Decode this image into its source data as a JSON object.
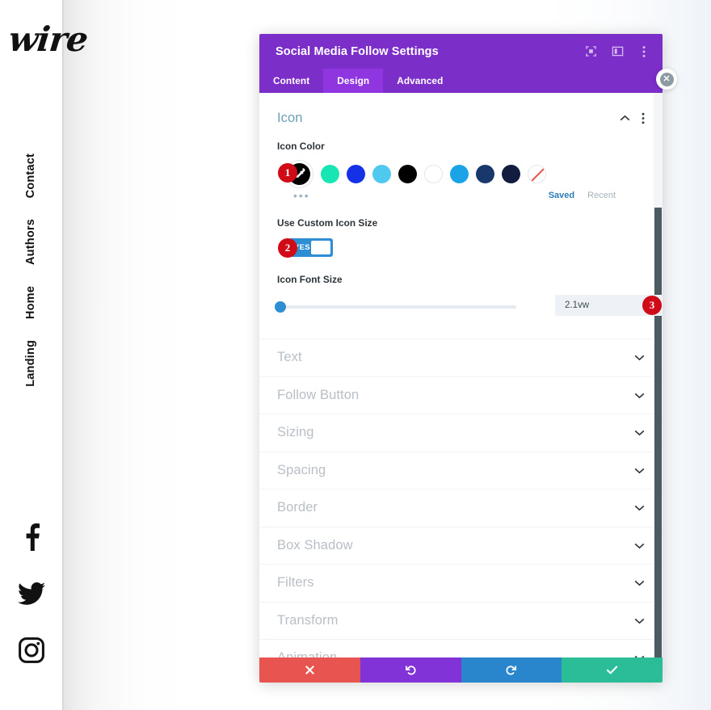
{
  "site": {
    "logo_text": "wire",
    "nav_items": [
      {
        "label": "Contact"
      },
      {
        "label": "Authors"
      },
      {
        "label": "Home"
      },
      {
        "label": "Landing"
      }
    ],
    "social_items": [
      {
        "name": "facebook"
      },
      {
        "name": "twitter"
      },
      {
        "name": "instagram"
      }
    ]
  },
  "modal": {
    "title": "Social Media Follow Settings",
    "header_icons": [
      {
        "name": "target-icon"
      },
      {
        "name": "layout-columns-icon"
      },
      {
        "name": "kebab-menu-icon"
      }
    ],
    "close_label": "✕",
    "tabs": [
      {
        "label": "Content",
        "active": false
      },
      {
        "label": "Design",
        "active": true
      },
      {
        "label": "Advanced",
        "active": false
      }
    ],
    "open_section": {
      "title": "Icon",
      "icon_color": {
        "label": "Icon Color",
        "badge": "1",
        "selected_color": "#000000",
        "selected_icon": "eyedropper-icon",
        "swatches": [
          {
            "color": "#17e6b4"
          },
          {
            "color": "#1531e8"
          },
          {
            "color": "#4fc9ef"
          },
          {
            "color": "#000000"
          },
          {
            "color": "#ffffff"
          },
          {
            "color": "#1ba3e8"
          },
          {
            "color": "#18376b"
          },
          {
            "color": "#111c3f"
          },
          {
            "color": "none"
          }
        ],
        "more_label": "•••",
        "saved_label": "Saved",
        "recent_label": "Recent"
      },
      "custom_icon_size": {
        "label": "Use Custom Icon Size",
        "badge": "2",
        "toggle_value": "YES"
      },
      "icon_font_size": {
        "label": "Icon Font Size",
        "badge": "3",
        "value": "2.1vw",
        "slider_percent": 1
      }
    },
    "collapsed_sections": [
      {
        "label": "Text"
      },
      {
        "label": "Follow Button"
      },
      {
        "label": "Sizing"
      },
      {
        "label": "Spacing"
      },
      {
        "label": "Border"
      },
      {
        "label": "Box Shadow"
      },
      {
        "label": "Filters"
      },
      {
        "label": "Transform"
      },
      {
        "label": "Animation"
      }
    ],
    "footer_buttons": [
      {
        "name": "cancel-button",
        "icon": "x-icon",
        "color": "#e8544f"
      },
      {
        "name": "undo-button",
        "icon": "undo-icon",
        "color": "#8133d7"
      },
      {
        "name": "redo-button",
        "icon": "redo-icon",
        "color": "#2a86cc"
      },
      {
        "name": "save-button",
        "icon": "check-icon",
        "color": "#2bbd97"
      }
    ]
  },
  "theme": {
    "purple": "#7b2ec8",
    "purple_active": "#9036e0",
    "accent_blue": "#2e8ed4",
    "badge_red": "#d10a17",
    "section_title": "#6c9eb5"
  }
}
